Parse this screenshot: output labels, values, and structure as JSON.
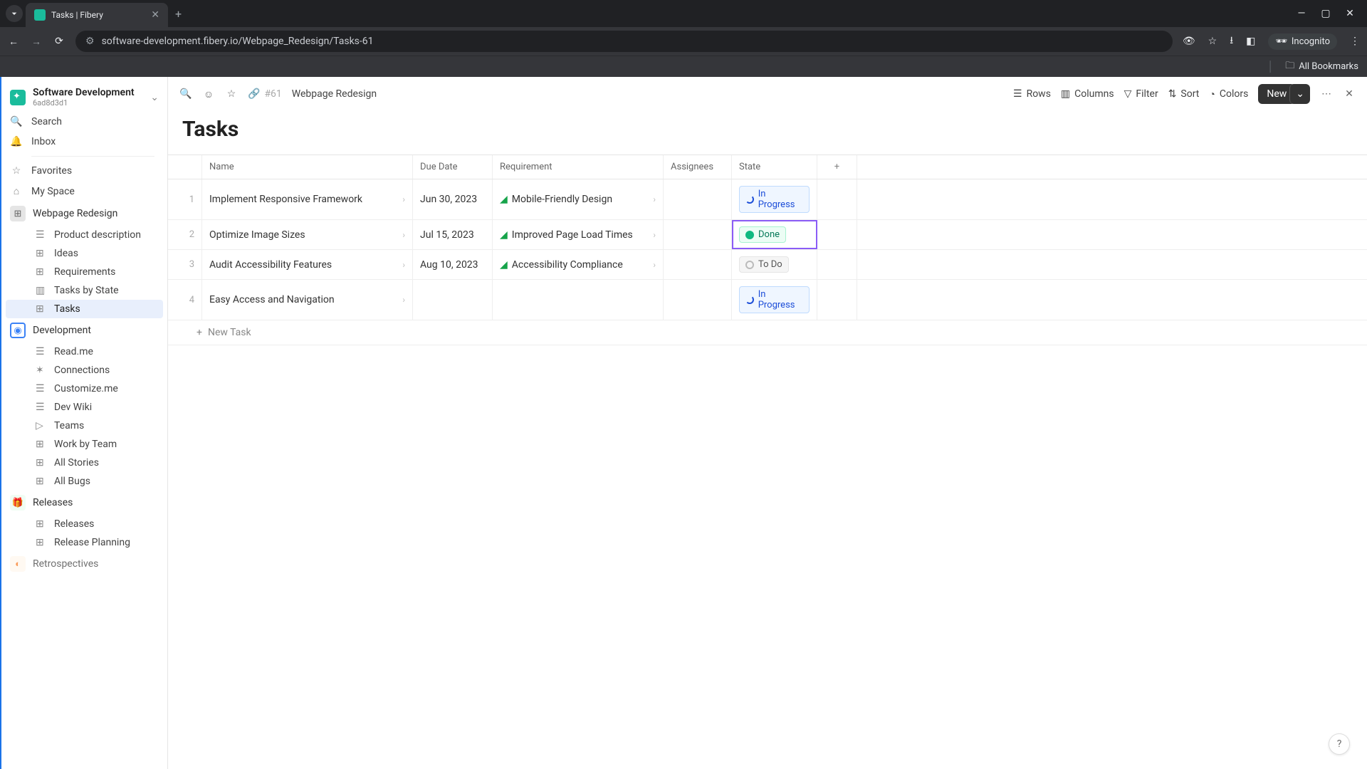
{
  "browser": {
    "tab_title": "Tasks | Fibery",
    "url": "software-development.fibery.io/Webpage_Redesign/Tasks-61",
    "incognito_label": "Incognito",
    "all_bookmarks": "All Bookmarks"
  },
  "workspace": {
    "name": "Software Development",
    "id": "6ad8d3d1"
  },
  "sidebar": {
    "search": "Search",
    "inbox": "Inbox",
    "favorites": "Favorites",
    "my_space": "My Space",
    "spaces": [
      {
        "name": "Webpage Redesign",
        "children": [
          {
            "label": "Product description"
          },
          {
            "label": "Ideas"
          },
          {
            "label": "Requirements"
          },
          {
            "label": "Tasks by State"
          },
          {
            "label": "Tasks",
            "active": true
          }
        ]
      },
      {
        "name": "Development",
        "children": [
          {
            "label": "Read.me"
          },
          {
            "label": "Connections"
          },
          {
            "label": "Customize.me"
          },
          {
            "label": "Dev Wiki"
          },
          {
            "label": "Teams"
          },
          {
            "label": "Work by Team"
          },
          {
            "label": "All Stories"
          },
          {
            "label": "All Bugs"
          }
        ]
      },
      {
        "name": "Releases",
        "children": [
          {
            "label": "Releases"
          },
          {
            "label": "Release Planning"
          }
        ]
      },
      {
        "name": "Retrospectives",
        "children": []
      }
    ]
  },
  "toolbar": {
    "breadcrumb_id": "#61",
    "breadcrumb_name": "Webpage Redesign",
    "rows": "Rows",
    "columns": "Columns",
    "filter": "Filter",
    "sort": "Sort",
    "colors": "Colors",
    "new_btn": "New"
  },
  "page": {
    "title": "Tasks"
  },
  "table": {
    "headers": {
      "name": "Name",
      "due": "Due Date",
      "req": "Requirement",
      "assign": "Assignees",
      "state": "State"
    },
    "rows": [
      {
        "num": "1",
        "name": "Implement Responsive Framework",
        "due": "Jun 30, 2023",
        "req": "Mobile-Friendly Design",
        "state": "In Progress",
        "state_kind": "progress"
      },
      {
        "num": "2",
        "name": "Optimize Image Sizes",
        "due": "Jul 15, 2023",
        "req": "Improved Page Load Times",
        "state": "Done",
        "state_kind": "done",
        "highlight": true
      },
      {
        "num": "3",
        "name": "Audit Accessibility Features",
        "due": "Aug 10, 2023",
        "req": "Accessibility Compliance",
        "state": "To Do",
        "state_kind": "todo"
      },
      {
        "num": "4",
        "name": "Easy Access and Navigation",
        "due": "",
        "req": "",
        "state": "In Progress",
        "state_kind": "progress"
      }
    ],
    "new_task": "New Task"
  }
}
